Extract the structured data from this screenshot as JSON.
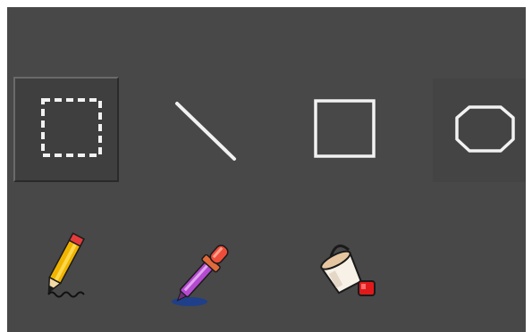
{
  "toolbox": {
    "selected_tool": "rectangle-select",
    "row1": [
      {
        "id": "rectangle-select",
        "icon": "dashed-rectangle-icon"
      },
      {
        "id": "line",
        "icon": "line-icon"
      },
      {
        "id": "rectangle",
        "icon": "rectangle-icon"
      },
      {
        "id": "rounded-rectangle",
        "icon": "rounded-rectangle-icon"
      }
    ],
    "row2": [
      {
        "id": "pencil",
        "icon": "pencil-icon"
      },
      {
        "id": "color-picker",
        "icon": "eyedropper-icon"
      },
      {
        "id": "fill",
        "icon": "paint-bucket-icon"
      }
    ]
  },
  "colors": {
    "background": "#484848",
    "selected_bg": "#3f3f3f",
    "icon_stroke": "#f2f2f2"
  }
}
